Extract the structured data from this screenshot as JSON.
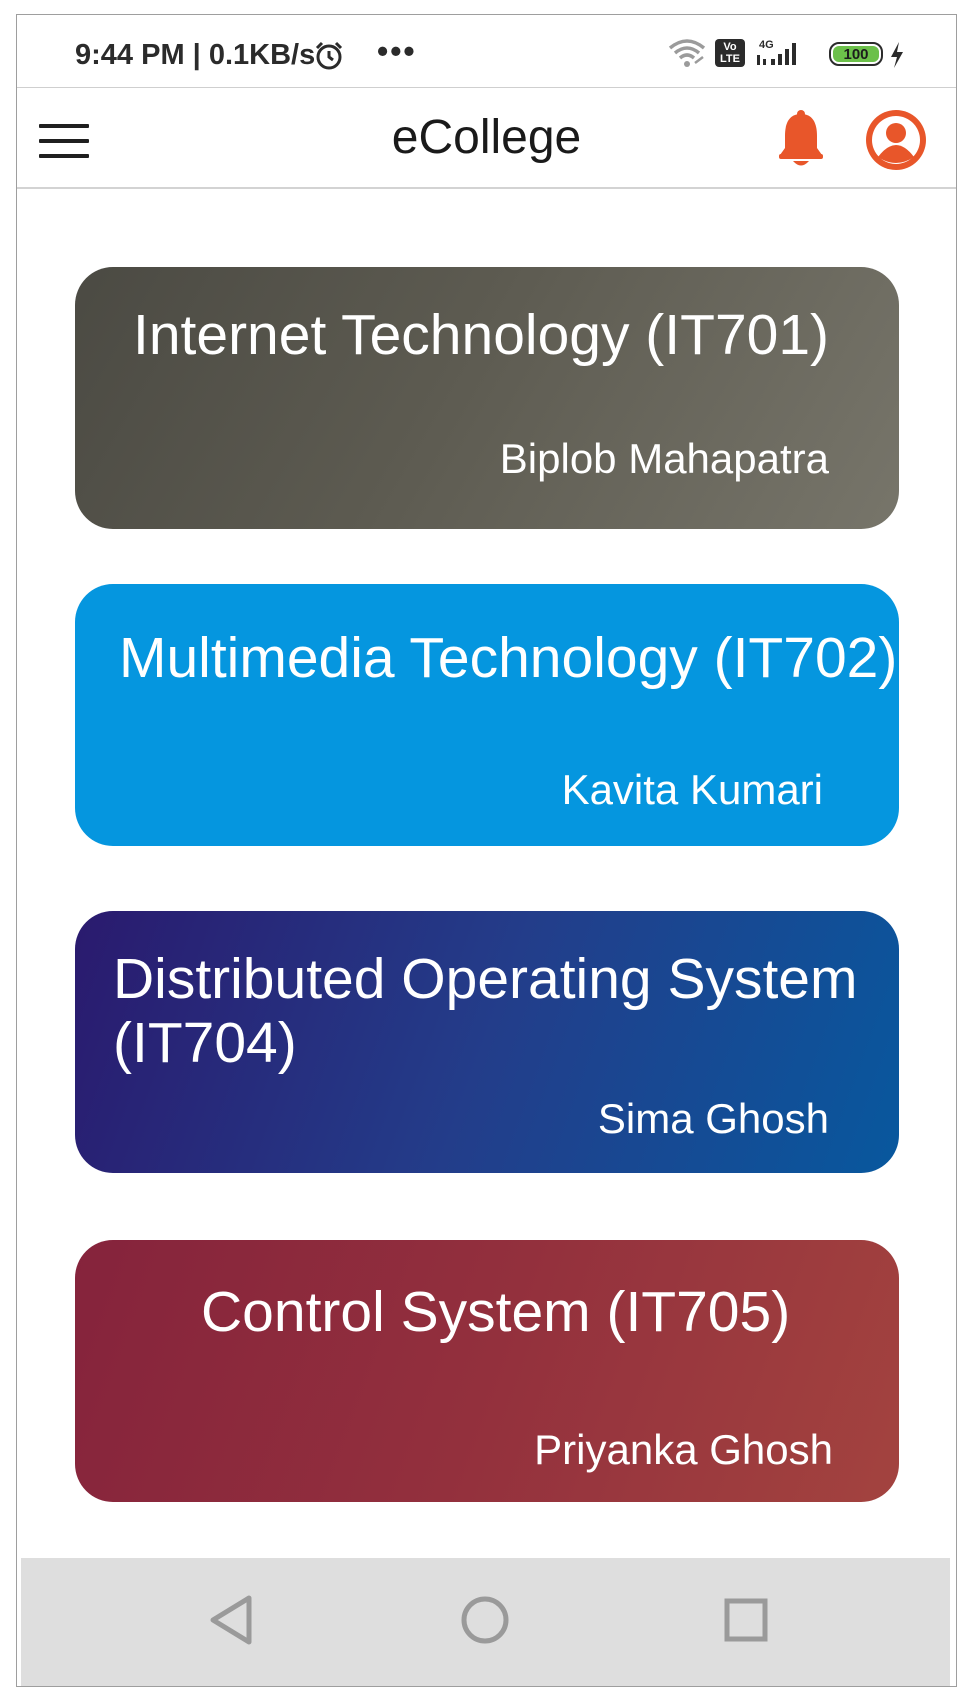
{
  "status_bar": {
    "time": "9:44 PM | 0.1KB/s",
    "overflow": "•••",
    "battery": "100",
    "network_label": "4G",
    "volte_label": "Vo LTE",
    "icons": [
      "alarm-icon",
      "wifi-icon",
      "volte-icon",
      "signal-icon",
      "battery-icon",
      "charging-icon"
    ]
  },
  "appbar": {
    "title": "eCollege",
    "menu_icon": "hamburger-menu-icon",
    "notification_icon": "bell-icon",
    "profile_icon": "user-profile-icon",
    "accent_color": "#e8562a"
  },
  "courses": [
    {
      "title": "Internet Technology (IT701)",
      "teacher": "Biplob Mahapatra",
      "color": "#5d5b51"
    },
    {
      "title": "Multimedia Technology (IT702)",
      "teacher": "Kavita Kumari",
      "color": "#0596df"
    },
    {
      "title_line1": "Distributed Operating System",
      "title_line2": "(IT704)",
      "teacher": "Sima Ghosh",
      "color": "#233d8a"
    },
    {
      "title": "Control System (IT705)",
      "teacher": "Priyanka Ghosh",
      "color": "#93303d"
    }
  ],
  "navbar": {
    "icons": [
      "back-triangle-icon",
      "home-circle-icon",
      "recents-square-icon"
    ]
  }
}
